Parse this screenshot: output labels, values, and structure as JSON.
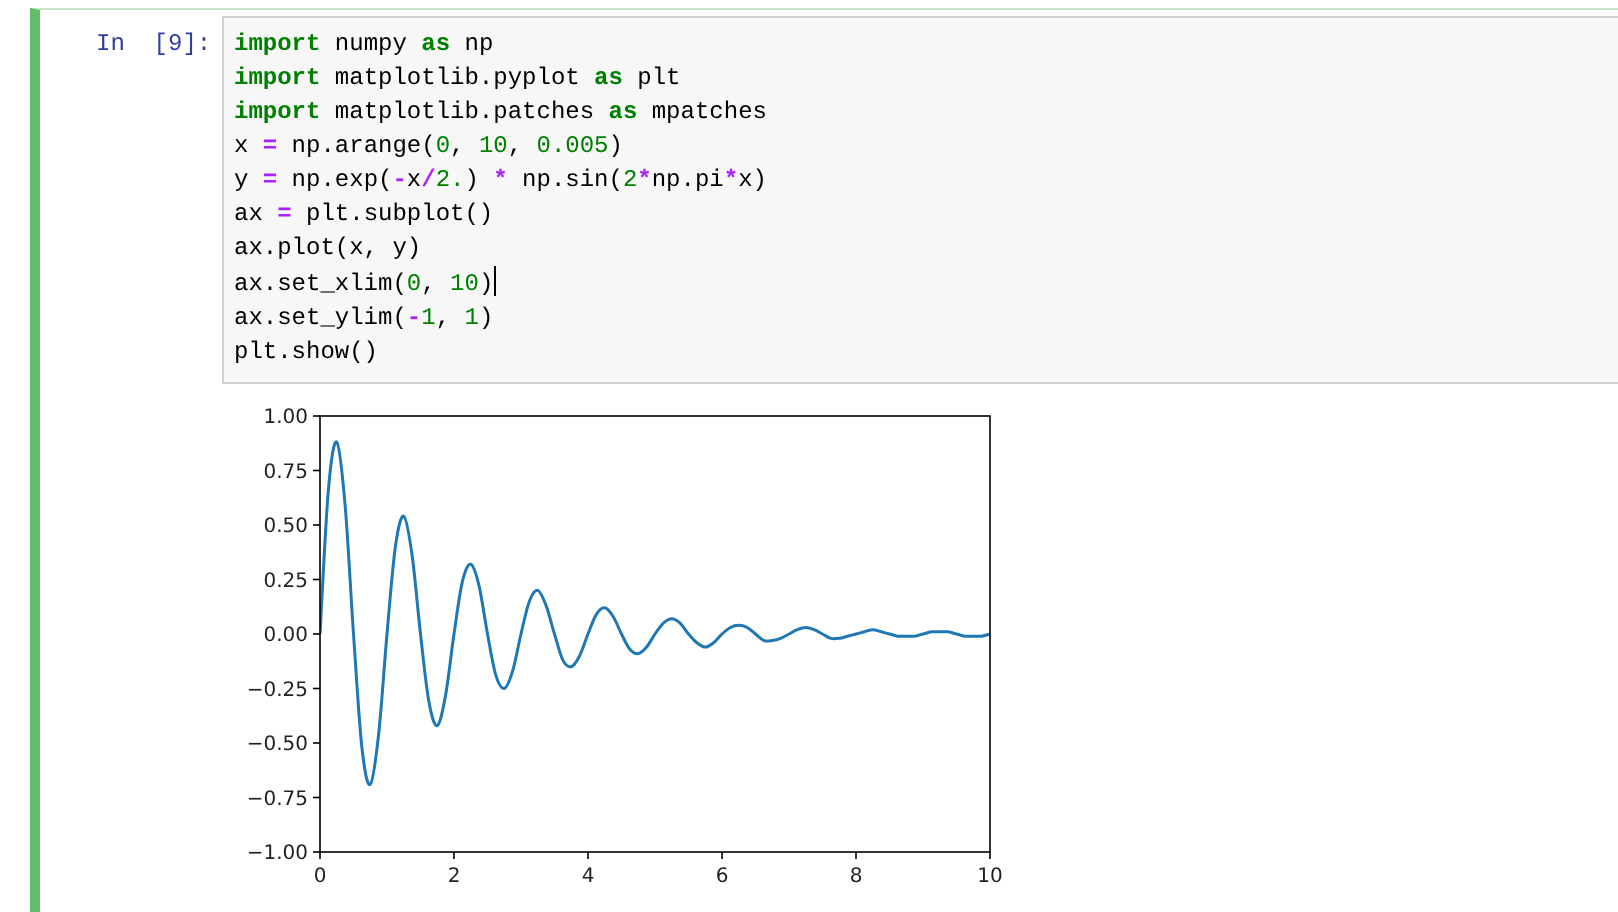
{
  "cell": {
    "prompt": "In  [9]:",
    "code": [
      {
        "tokens": [
          {
            "kind": "keyword",
            "text": "import"
          },
          {
            "kind": "plain",
            "text": " numpy "
          },
          {
            "kind": "keyword",
            "text": "as"
          },
          {
            "kind": "plain",
            "text": " np"
          }
        ]
      },
      {
        "tokens": [
          {
            "kind": "keyword",
            "text": "import"
          },
          {
            "kind": "plain",
            "text": " matplotlib.pyplot "
          },
          {
            "kind": "keyword",
            "text": "as"
          },
          {
            "kind": "plain",
            "text": " plt"
          }
        ]
      },
      {
        "tokens": [
          {
            "kind": "keyword",
            "text": "import"
          },
          {
            "kind": "plain",
            "text": " matplotlib.patches "
          },
          {
            "kind": "keyword",
            "text": "as"
          },
          {
            "kind": "plain",
            "text": " mpatches"
          }
        ]
      },
      {
        "tokens": [
          {
            "kind": "plain",
            "text": "x "
          },
          {
            "kind": "operator",
            "text": "="
          },
          {
            "kind": "plain",
            "text": " np.arange("
          },
          {
            "kind": "number",
            "text": "0"
          },
          {
            "kind": "plain",
            "text": ", "
          },
          {
            "kind": "number",
            "text": "10"
          },
          {
            "kind": "plain",
            "text": ", "
          },
          {
            "kind": "number",
            "text": "0.005"
          },
          {
            "kind": "plain",
            "text": ")"
          }
        ]
      },
      {
        "tokens": [
          {
            "kind": "plain",
            "text": "y "
          },
          {
            "kind": "operator",
            "text": "="
          },
          {
            "kind": "plain",
            "text": " np.exp("
          },
          {
            "kind": "operator",
            "text": "-"
          },
          {
            "kind": "plain",
            "text": "x"
          },
          {
            "kind": "operator",
            "text": "/"
          },
          {
            "kind": "number",
            "text": "2."
          },
          {
            "kind": "plain",
            "text": ") "
          },
          {
            "kind": "operator",
            "text": "*"
          },
          {
            "kind": "plain",
            "text": " np.sin("
          },
          {
            "kind": "number",
            "text": "2"
          },
          {
            "kind": "operator",
            "text": "*"
          },
          {
            "kind": "plain",
            "text": "np.pi"
          },
          {
            "kind": "operator",
            "text": "*"
          },
          {
            "kind": "plain",
            "text": "x)"
          }
        ]
      },
      {
        "tokens": [
          {
            "kind": "plain",
            "text": "ax "
          },
          {
            "kind": "operator",
            "text": "="
          },
          {
            "kind": "plain",
            "text": " plt.subplot()"
          }
        ]
      },
      {
        "tokens": [
          {
            "kind": "plain",
            "text": "ax.plot(x, y)"
          }
        ]
      },
      {
        "cursor": true,
        "tokens": [
          {
            "kind": "plain",
            "text": "ax.set_xlim("
          },
          {
            "kind": "number",
            "text": "0"
          },
          {
            "kind": "plain",
            "text": ", "
          },
          {
            "kind": "number",
            "text": "10"
          },
          {
            "kind": "plain",
            "text": ")"
          }
        ]
      },
      {
        "tokens": [
          {
            "kind": "plain",
            "text": "ax.set_ylim("
          },
          {
            "kind": "operator",
            "text": "-"
          },
          {
            "kind": "number",
            "text": "1"
          },
          {
            "kind": "plain",
            "text": ", "
          },
          {
            "kind": "number",
            "text": "1"
          },
          {
            "kind": "plain",
            "text": ")"
          }
        ]
      },
      {
        "tokens": [
          {
            "kind": "plain",
            "text": "plt.show()"
          }
        ]
      }
    ],
    "output": {
      "chart_data": {
        "type": "line",
        "xlim": [
          0,
          10
        ],
        "ylim": [
          -1,
          1
        ],
        "xticks": [
          0,
          2,
          4,
          6,
          8,
          10
        ],
        "yticks": [
          {
            "value": 1,
            "label": "1.00"
          },
          {
            "value": 0.75,
            "label": "0.75"
          },
          {
            "value": 0.5,
            "label": "0.50"
          },
          {
            "value": 0.25,
            "label": "0.25"
          },
          {
            "value": 0,
            "label": "0.00"
          },
          {
            "value": -0.25,
            "label": "−0.25"
          },
          {
            "value": -0.5,
            "label": "−0.50"
          },
          {
            "value": -0.75,
            "label": "−0.75"
          },
          {
            "value": -1,
            "label": "−1.00"
          }
        ],
        "x": [
          0,
          0.125,
          0.25,
          0.375,
          0.5,
          0.625,
          0.75,
          0.875,
          1,
          1.125,
          1.25,
          1.375,
          1.5,
          1.625,
          1.75,
          1.875,
          2,
          2.125,
          2.25,
          2.375,
          2.5,
          2.625,
          2.75,
          2.875,
          3,
          3.125,
          3.25,
          3.375,
          3.5,
          3.625,
          3.75,
          3.875,
          4,
          4.125,
          4.25,
          4.375,
          4.5,
          4.625,
          4.75,
          4.875,
          5,
          5.125,
          5.25,
          5.375,
          5.5,
          5.625,
          5.75,
          5.875,
          6,
          6.125,
          6.25,
          6.375,
          6.5,
          6.625,
          6.75,
          6.875,
          7,
          7.125,
          7.25,
          7.375,
          7.5,
          7.625,
          7.75,
          7.875,
          8,
          8.125,
          8.25,
          8.375,
          8.5,
          8.625,
          8.75,
          8.875,
          9,
          9.125,
          9.25,
          9.375,
          9.5,
          9.625,
          9.75,
          9.875,
          10
        ],
        "series": [
          {
            "color": "#1f77b4",
            "values": [
              0,
              0.66,
              0.88,
              0.59,
              0,
              -0.52,
              -0.69,
              -0.46,
              0,
              0.4,
              0.54,
              0.36,
              0,
              -0.31,
              -0.42,
              -0.28,
              0,
              0.24,
              0.32,
              0.22,
              0,
              -0.19,
              -0.25,
              -0.17,
              0,
              0.15,
              0.2,
              0.13,
              0,
              -0.12,
              -0.15,
              -0.1,
              0,
              0.09,
              0.12,
              0.08,
              0,
              -0.07,
              -0.09,
              -0.06,
              0,
              0.05,
              0.07,
              0.05,
              0,
              -0.04,
              -0.06,
              -0.04,
              0,
              0.03,
              0.04,
              0.03,
              0,
              -0.03,
              -0.03,
              -0.02,
              0,
              0.02,
              0.03,
              0.02,
              0,
              -0.02,
              -0.02,
              -0.01,
              0,
              0.01,
              0.02,
              0.01,
              0,
              -0.01,
              -0.01,
              -0.01,
              0,
              0.01,
              0.01,
              0.01,
              0,
              -0.01,
              -0.01,
              -0.01,
              0
            ]
          }
        ]
      }
    }
  }
}
